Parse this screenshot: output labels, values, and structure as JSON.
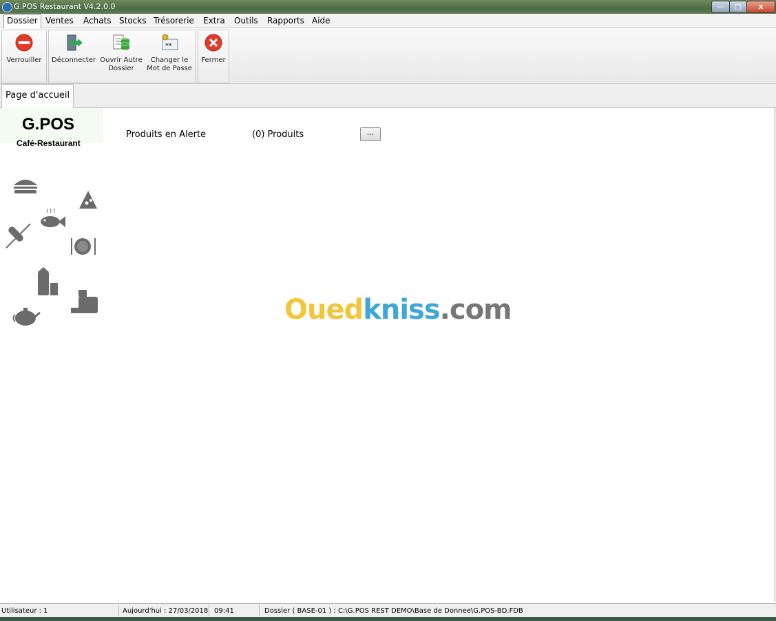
{
  "window": {
    "title": "G.POS Restaurant V4.2.0.0",
    "min_label": "—",
    "max_label": "□",
    "close_label": "x"
  },
  "menu": {
    "items": [
      "Dossier",
      "Ventes",
      "Achats",
      "Stocks",
      "Trésorerie",
      "Extra",
      "Outils",
      "Rapports",
      "Aide"
    ]
  },
  "ribbon": {
    "verrouiller": "Verrouiller",
    "deconnecter": "Déconnecter",
    "ouvrir_1": "Ouvrir Autre",
    "ouvrir_2": "Dossier",
    "changer_1": "Changer le",
    "changer_2": "Mot de Passe",
    "fermer": "Fermer"
  },
  "tabs": {
    "home": "Page d'accueil"
  },
  "logo": {
    "main": "G.POS",
    "sub": "Café-Restaurant"
  },
  "home": {
    "alert_label": "Produits en Alerte",
    "alert_count": "(0) Produits",
    "alert_button": "..."
  },
  "watermark": {
    "part1": "Oued",
    "part2": "kniss",
    "part3": ".com"
  },
  "status": {
    "user": "Utilisateur : 1",
    "date": "Aujourd'hui : 27/03/2018",
    "time": "09:41",
    "dossier": "Dossier ( BASE-01 )  : C:\\G.POS REST DEMO\\Base de Donnee\\G.POS-BD.FDB"
  },
  "colors": {
    "accent_red": "#e23b2a",
    "icon_grey": "#6b6b6b"
  }
}
